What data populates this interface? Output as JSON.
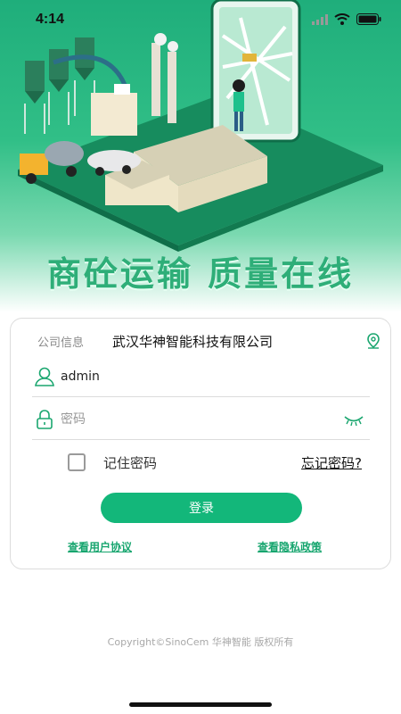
{
  "status_bar": {
    "time": "4:14",
    "icons": [
      "signal-icon",
      "wifi-icon",
      "battery-icon"
    ]
  },
  "hero": {
    "slogan": "商砼运输 质量在线",
    "colors": {
      "primary": "#1fae7b",
      "slogan": "#2eae78"
    }
  },
  "login": {
    "company_label": "公司信息",
    "company_value": "武汉华神智能科技有限公司",
    "username_value": "admin",
    "password_placeholder": "密码",
    "remember_label": "记住密码",
    "remember_checked": false,
    "forgot_link": "忘记密码?",
    "submit_label": "登录",
    "agreement_link": "查看用户协议",
    "privacy_link": "查看隐私政策"
  },
  "footer": {
    "copyright": "Copyright©SinoCem 华神智能 版权所有"
  }
}
